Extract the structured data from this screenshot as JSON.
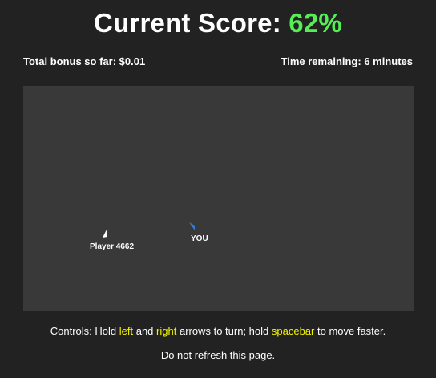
{
  "header": {
    "score_label": "Current Score:",
    "score_value": "62%"
  },
  "stats": {
    "bonus": "Total bonus so far: $0.01",
    "time": "Time remaining: 6 minutes"
  },
  "arena": {
    "other_player": {
      "label": "Player 4662",
      "color": "#ffffff"
    },
    "you": {
      "label": "YOU",
      "color": "#2f7fd4"
    }
  },
  "controls": {
    "prefix": "Controls: Hold",
    "key_left": "left",
    "and": "and",
    "key_right": "right",
    "middle": "arrows to turn; hold",
    "key_space": "spacebar",
    "suffix": "to move faster."
  },
  "footer": {
    "note": "Do not refresh this page."
  },
  "colors": {
    "background": "#222222",
    "arena": "#393939",
    "score_green": "#55ee55",
    "key_yellow": "#f2f200"
  }
}
